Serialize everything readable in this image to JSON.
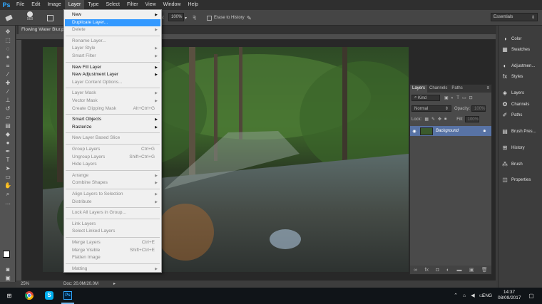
{
  "menubar": {
    "logo": "Ps",
    "items": [
      "File",
      "Edit",
      "Image",
      "Layer",
      "Type",
      "Select",
      "Filter",
      "View",
      "Window",
      "Help"
    ]
  },
  "options": {
    "brush_size": "500",
    "flow_label": "Flow:",
    "flow_value": "100%",
    "erase_history": "Erase to History",
    "workspace": "Essentials"
  },
  "document": {
    "tab_label": "Flowing Water Blur.p...",
    "zoom": "25%",
    "doc_info": "Doc: 20.0M/20.0M"
  },
  "layer_menu": {
    "items": [
      {
        "label": "New",
        "submenu": true,
        "disabled": false
      },
      {
        "label": "Duplicate Layer...",
        "highlighted": true,
        "disabled": false
      },
      {
        "label": "Delete",
        "submenu": true,
        "disabled": true
      },
      {
        "sep": true
      },
      {
        "label": "Rename Layer...",
        "disabled": true
      },
      {
        "label": "Layer Style",
        "submenu": true,
        "disabled": true
      },
      {
        "label": "Smart Filter",
        "submenu": true,
        "disabled": true
      },
      {
        "sep": true
      },
      {
        "label": "New Fill Layer",
        "submenu": true,
        "disabled": false
      },
      {
        "label": "New Adjustment Layer",
        "submenu": true,
        "disabled": false
      },
      {
        "label": "Layer Content Options...",
        "disabled": true
      },
      {
        "sep": true
      },
      {
        "label": "Layer Mask",
        "submenu": true,
        "disabled": true
      },
      {
        "label": "Vector Mask",
        "submenu": true,
        "disabled": true
      },
      {
        "label": "Create Clipping Mask",
        "shortcut": "Alt+Ctrl+G",
        "disabled": true
      },
      {
        "sep": true
      },
      {
        "label": "Smart Objects",
        "submenu": true,
        "disabled": false
      },
      {
        "label": "Rasterize",
        "submenu": true,
        "disabled": false
      },
      {
        "sep": true
      },
      {
        "label": "New Layer Based Slice",
        "disabled": true
      },
      {
        "sep": true
      },
      {
        "label": "Group Layers",
        "shortcut": "Ctrl+G",
        "disabled": true
      },
      {
        "label": "Ungroup Layers",
        "shortcut": "Shift+Ctrl+G",
        "disabled": true
      },
      {
        "label": "Hide Layers",
        "disabled": true
      },
      {
        "sep": true
      },
      {
        "label": "Arrange",
        "submenu": true,
        "disabled": true
      },
      {
        "label": "Combine Shapes",
        "submenu": true,
        "disabled": true
      },
      {
        "sep": true
      },
      {
        "label": "Align Layers to Selection",
        "submenu": true,
        "disabled": true
      },
      {
        "label": "Distribute",
        "submenu": true,
        "disabled": true
      },
      {
        "sep": true
      },
      {
        "label": "Lock All Layers in Group...",
        "disabled": true
      },
      {
        "sep": true
      },
      {
        "label": "Link Layers",
        "disabled": true
      },
      {
        "label": "Select Linked Layers",
        "disabled": true
      },
      {
        "sep": true
      },
      {
        "label": "Merge Layers",
        "shortcut": "Ctrl+E",
        "disabled": true
      },
      {
        "label": "Merge Visible",
        "shortcut": "Shift+Ctrl+E",
        "disabled": true
      },
      {
        "label": "Flatten Image",
        "disabled": true
      },
      {
        "sep": true
      },
      {
        "label": "Matting",
        "submenu": true,
        "disabled": true
      }
    ]
  },
  "layers_panel": {
    "tabs": [
      "Layers",
      "Channels",
      "Paths"
    ],
    "filter_label": "Kind",
    "blend_mode": "Normal",
    "opacity_label": "Opacity:",
    "opacity_value": "100%",
    "lock_label": "Lock:",
    "fill_label": "Fill:",
    "fill_value": "100%",
    "layer_name": "Background"
  },
  "dock": {
    "items": [
      "Color",
      "Swatches",
      "Adjustmen...",
      "Styles",
      "Layers",
      "Channels",
      "Paths",
      "Brush Pres...",
      "History",
      "Brush",
      "Properties"
    ]
  },
  "taskbar": {
    "language": "ENG",
    "time": "14:37",
    "date": "08/09/2017"
  }
}
